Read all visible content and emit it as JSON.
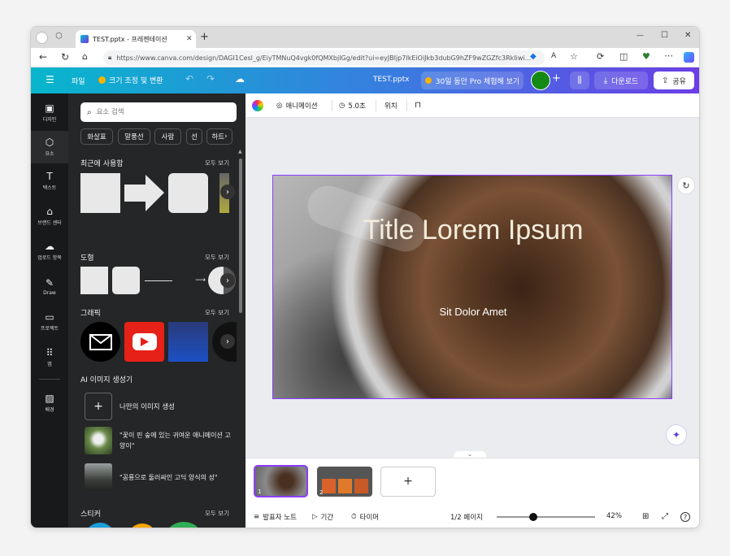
{
  "browser": {
    "tab_title": "TEST.pptx - 프레젠테이션",
    "new_tab": "+",
    "url": "https://www.canva.com/design/DAGI1Cesl_g/EiyTMNuQ4vgk0fQMXbjIGg/edit?ui=eyJBIjp7IkEiOiJkb3dubG9hZF9wZGZfc3RkIiwi...",
    "window_controls": [
      "—",
      "☐",
      "✕"
    ]
  },
  "topbar": {
    "menu_icon": "☰",
    "file_label": "파일",
    "resize_label": "크기 조정 및 변환",
    "doc_title": "TEST.pptx",
    "pro_trial_label": "30일 동안 Pro 체험해 보기",
    "download_label": "다운로드",
    "share_label": "공유",
    "accent": "#7d2ae8"
  },
  "rail": {
    "items": [
      {
        "icon": "layout-icon",
        "glyph": "▣",
        "label": "디자인"
      },
      {
        "icon": "elements-icon",
        "glyph": "⬡",
        "label": "요소"
      },
      {
        "icon": "text-icon",
        "glyph": "T",
        "label": "텍스트"
      },
      {
        "icon": "brand-icon",
        "glyph": "⌂",
        "label": "브랜드 센터"
      },
      {
        "icon": "upload-icon",
        "glyph": "☁",
        "label": "업로드 항목"
      },
      {
        "icon": "draw-icon",
        "glyph": "✎",
        "label": "Draw"
      },
      {
        "icon": "folder-icon",
        "glyph": "▭",
        "label": "프로젝트"
      },
      {
        "icon": "apps-icon",
        "glyph": "⠿",
        "label": "앱"
      },
      {
        "icon": "background-icon",
        "glyph": "▨",
        "label": "배경"
      }
    ]
  },
  "panel": {
    "search_placeholder": "요소 검색",
    "chips": [
      "화살표",
      "말풍선",
      "사람",
      "선",
      "하트"
    ],
    "recent_title": "최근에 사용함",
    "shapes_title": "도형",
    "graphics_title": "그래픽",
    "ai_title": "AI 이미지 생성기",
    "ai_create": "나만의 이미지 생성",
    "ai_item1": "\"꽃이 핀 숲에 있는 귀여운 애니메이션 고양이\"",
    "ai_item2": "\"꽁룡으로 둘러싸인 고딕 양식의 성\"",
    "stickers_title": "스티커",
    "see_all": "모두 보기"
  },
  "toolbar2": {
    "animation_label": "애니메이션",
    "duration_label": "5.0초",
    "position_label": "위치"
  },
  "slide": {
    "title": "Title Lorem Ipsum",
    "subtitle": "Sit Dolor Amet"
  },
  "bottom": {
    "notes_label": "발표자 노트",
    "duration_label": "기간",
    "timer_label": "타이머",
    "page_indicator": "1/2 페이지",
    "zoom_level": "42%",
    "zoom_fraction": 0.42,
    "thumb1_number": "1",
    "thumb2_number": "2",
    "add_page": "+"
  }
}
